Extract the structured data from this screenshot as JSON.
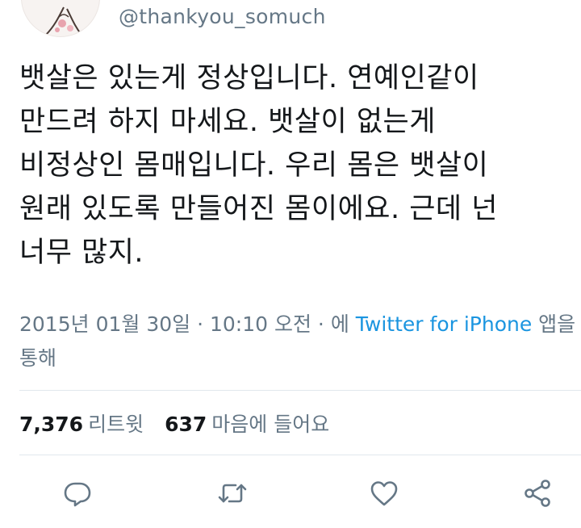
{
  "header": {
    "handle": "@thankyou_somuch",
    "avatar_icon": "avatar-image"
  },
  "tweet": {
    "text": "뱃살은 있는게 정상입니다. 연예인같이\n만드려 하지 마세요. 뱃살이 없는게\n비정상인 몸매입니다. 우리 몸은 뱃살이\n원래 있도록 만들어진 몸이에요. 근데 넌\n너무 많지."
  },
  "meta": {
    "date": "2015년 01월 30일",
    "sep1": " · ",
    "time": "10:10 오전",
    "sep2": " · 에 ",
    "source": "Twitter for iPhone",
    "suffix": " 앱을",
    "line2": "통해"
  },
  "stats": {
    "retweets_count": "7,376",
    "retweets_label": "리트윗",
    "likes_count": "637",
    "likes_label": "마음에 들어요"
  },
  "actions": {
    "reply_icon": "reply-icon",
    "retweet_icon": "retweet-icon",
    "like_icon": "heart-icon",
    "share_icon": "share-icon"
  },
  "colors": {
    "text": "#14171a",
    "secondary": "#657786",
    "link": "#1b95e0",
    "divider": "#e1e8ed",
    "icon": "#657786"
  }
}
